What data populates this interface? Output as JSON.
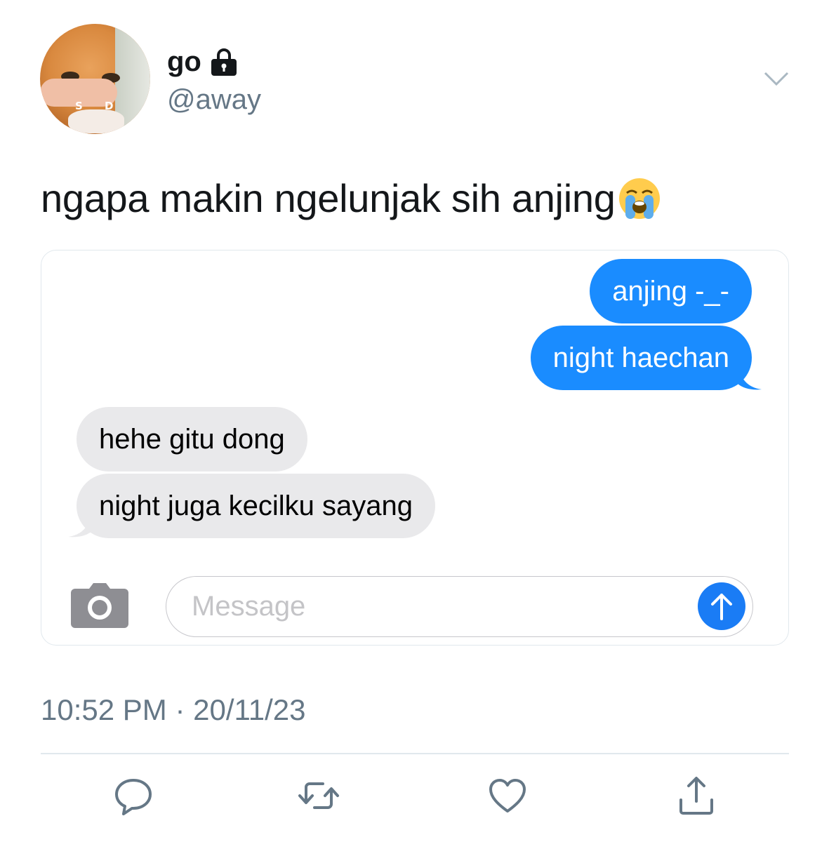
{
  "tweet": {
    "display_name": "go",
    "handle": "@away",
    "text": "ngapa makin ngelunjak sih anjing",
    "text_emoji": "loudly-crying-face",
    "timestamp": "10:52 PM · 20/11/23",
    "avatar_letters": [
      "S",
      "D"
    ]
  },
  "chat": {
    "messages": [
      {
        "direction": "outgoing",
        "text": "anjing -_-"
      },
      {
        "direction": "outgoing",
        "text": "night haechan"
      },
      {
        "direction": "incoming",
        "text": "hehe gitu dong"
      },
      {
        "direction": "incoming",
        "text": "night juga kecilku sayang"
      }
    ],
    "input_placeholder": "Message"
  },
  "icons": {
    "lock": "lock-icon",
    "menu": "chevron-down-icon",
    "camera": "camera-icon",
    "send": "arrow-up-icon",
    "reply": "comment-icon",
    "retweet": "retweet-icon",
    "like": "heart-icon",
    "share": "share-icon"
  },
  "colors": {
    "outgoing_bubble": "#1a8cff",
    "incoming_bubble": "#e9e9eb",
    "secondary_text": "#657786",
    "send_button": "#1a7cf5"
  }
}
